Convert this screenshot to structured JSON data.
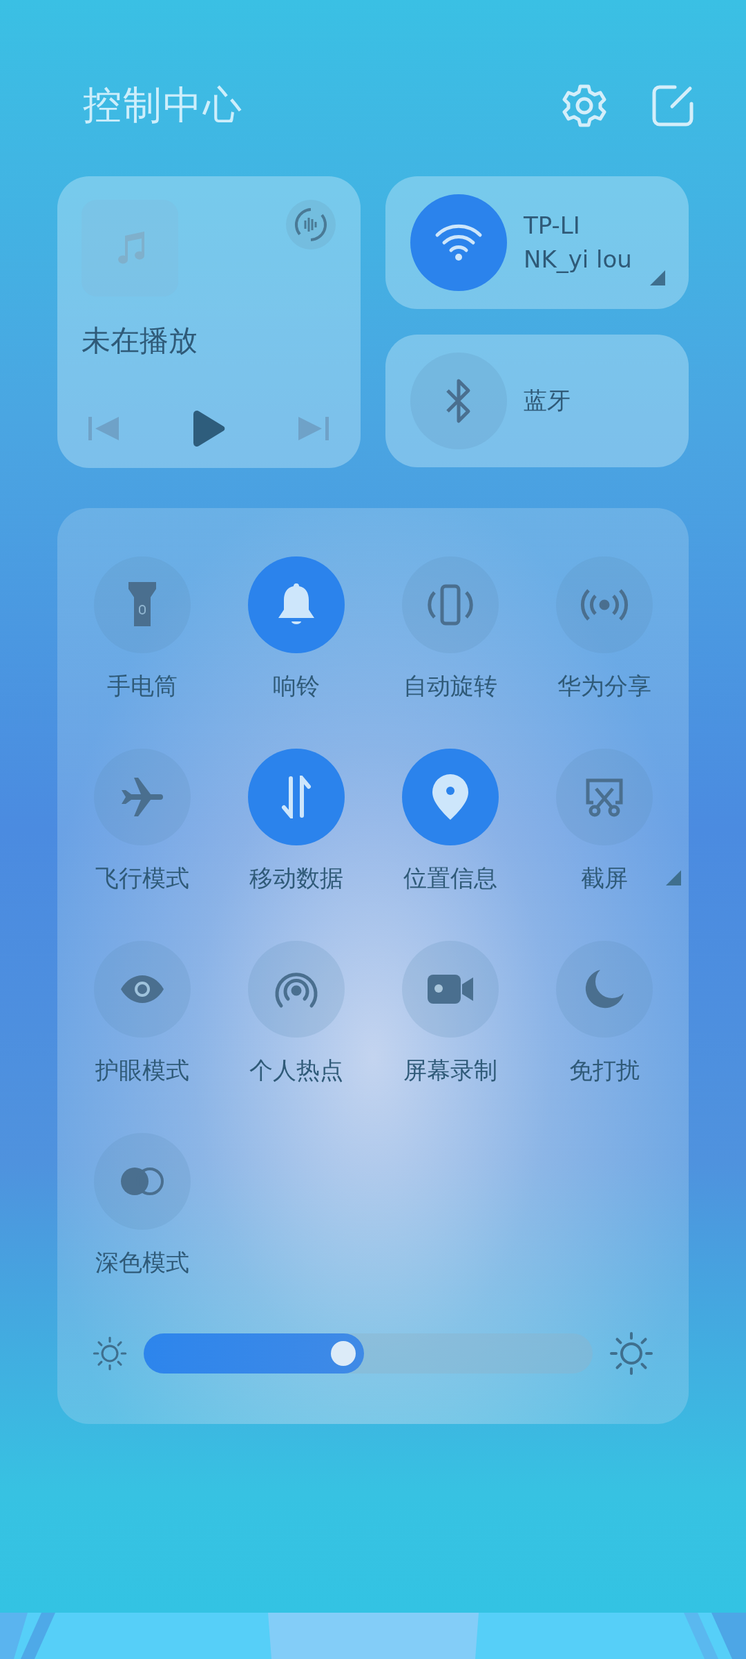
{
  "header": {
    "title": "控制中心"
  },
  "media": {
    "status": "未在播放"
  },
  "connections": [
    {
      "kind": "wifi",
      "label": "TP-LI\nNK_yi lou",
      "on": true,
      "expandable": true
    },
    {
      "kind": "bluetooth",
      "label": "蓝牙",
      "on": false,
      "expandable": false
    }
  ],
  "toggles": [
    {
      "label": "手电筒",
      "on": false,
      "expandable": false
    },
    {
      "label": "响铃",
      "on": true,
      "expandable": false
    },
    {
      "label": "自动旋转",
      "on": false,
      "expandable": false
    },
    {
      "label": "华为分享",
      "on": false,
      "expandable": false
    },
    {
      "label": "飞行模式",
      "on": false,
      "expandable": false
    },
    {
      "label": "移动数据",
      "on": true,
      "expandable": false
    },
    {
      "label": "位置信息",
      "on": true,
      "expandable": false
    },
    {
      "label": "截屏",
      "on": false,
      "expandable": true
    },
    {
      "label": "护眼模式",
      "on": false,
      "expandable": false
    },
    {
      "label": "个人热点",
      "on": false,
      "expandable": false
    },
    {
      "label": "屏幕录制",
      "on": false,
      "expandable": false
    },
    {
      "label": "免打扰",
      "on": false,
      "expandable": false
    },
    {
      "label": "深色模式",
      "on": false,
      "expandable": false
    }
  ],
  "brightness": {
    "level": 0.49
  }
}
